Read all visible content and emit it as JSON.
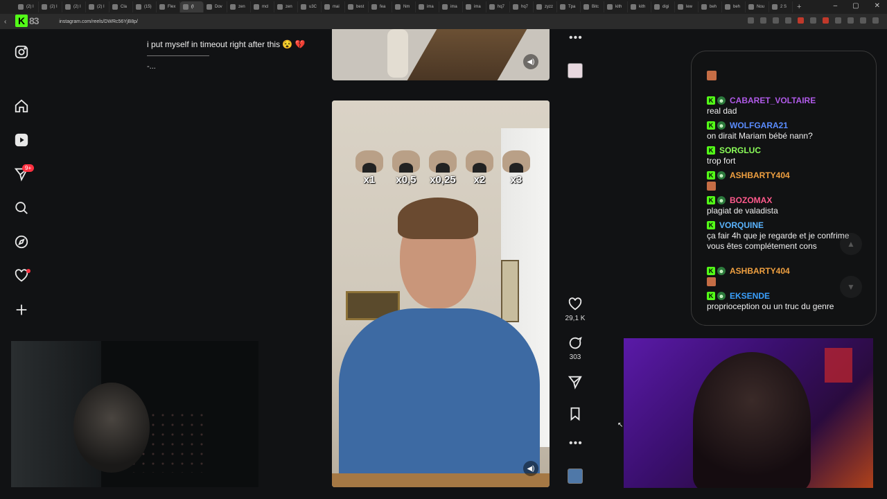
{
  "browser": {
    "tabs": [
      {
        "label": "(2) I",
        "active": false
      },
      {
        "label": "(2) I",
        "active": false
      },
      {
        "label": "(2) I",
        "active": false
      },
      {
        "label": "(2) I",
        "active": false
      },
      {
        "label": "Cla",
        "active": false
      },
      {
        "label": "(15)",
        "active": false
      },
      {
        "label": "Flex",
        "active": false
      },
      {
        "label": "(I",
        "active": true
      },
      {
        "label": "Dov",
        "active": false
      },
      {
        "label": "zen",
        "active": false
      },
      {
        "label": "mcl",
        "active": false
      },
      {
        "label": "zen",
        "active": false
      },
      {
        "label": "u3C",
        "active": false
      },
      {
        "label": "mai",
        "active": false
      },
      {
        "label": "best",
        "active": false
      },
      {
        "label": "fea",
        "active": false
      },
      {
        "label": "Nm",
        "active": false
      },
      {
        "label": "ima",
        "active": false
      },
      {
        "label": "ima",
        "active": false
      },
      {
        "label": "ima",
        "active": false
      },
      {
        "label": "hq7",
        "active": false
      },
      {
        "label": "hq7",
        "active": false
      },
      {
        "label": "zyzz",
        "active": false
      },
      {
        "label": "Tpa",
        "active": false
      },
      {
        "label": "Bitc",
        "active": false
      },
      {
        "label": "kith",
        "active": false
      },
      {
        "label": "kith",
        "active": false
      },
      {
        "label": "digi",
        "active": false
      },
      {
        "label": "lew",
        "active": false
      },
      {
        "label": "beh",
        "active": false
      },
      {
        "label": "beh",
        "active": false
      },
      {
        "label": "Nou",
        "active": false
      },
      {
        "label": "2 S",
        "active": false
      }
    ],
    "new_tab": "+",
    "url": "instagram.com/reels/DWRc56YjB8p/",
    "logo_number": "83",
    "window_controls": [
      "–",
      "▢",
      "✕"
    ]
  },
  "sidebar": {
    "badge_count": "9+"
  },
  "post": {
    "caption": "i put myself in timeout right after this 😵 💔",
    "more": "-..."
  },
  "reel": {
    "speed_labels": [
      "x1",
      "x0,5",
      "x0,25",
      "x2",
      "x3"
    ],
    "likes": "29,1 K",
    "comments": "303"
  },
  "chat": {
    "messages": [
      {
        "user": "CABARET_VOLTAIRE",
        "color": "#b05ae8",
        "text": "real dad",
        "sub": true
      },
      {
        "user": "WOLFGARA21",
        "color": "#5a8cff",
        "text": "on dirait Mariam bébé nann?",
        "sub": true
      },
      {
        "user": "SORGLUC",
        "color": "#8cff5a",
        "text": "trop fort",
        "sub": false
      },
      {
        "user": "ASHBARTY404",
        "color": "#f0a040",
        "text": "",
        "sub": true
      },
      {
        "user": "BOZOMAX",
        "color": "#ff5a8c",
        "text": "plagiat de valadista",
        "sub": true
      },
      {
        "user": "VORQUINE",
        "color": "#5ab4ff",
        "text": "ça fair 4h que je regarde et je confrime vous êtes complétement cons",
        "sub": false
      },
      {
        "user": "ASHBARTY404",
        "color": "#f0a040",
        "text": "",
        "sub": true
      },
      {
        "user": "EKSENDE",
        "color": "#3aa0ff",
        "text": "proprioception ou un truc du genre",
        "sub": true
      }
    ]
  }
}
